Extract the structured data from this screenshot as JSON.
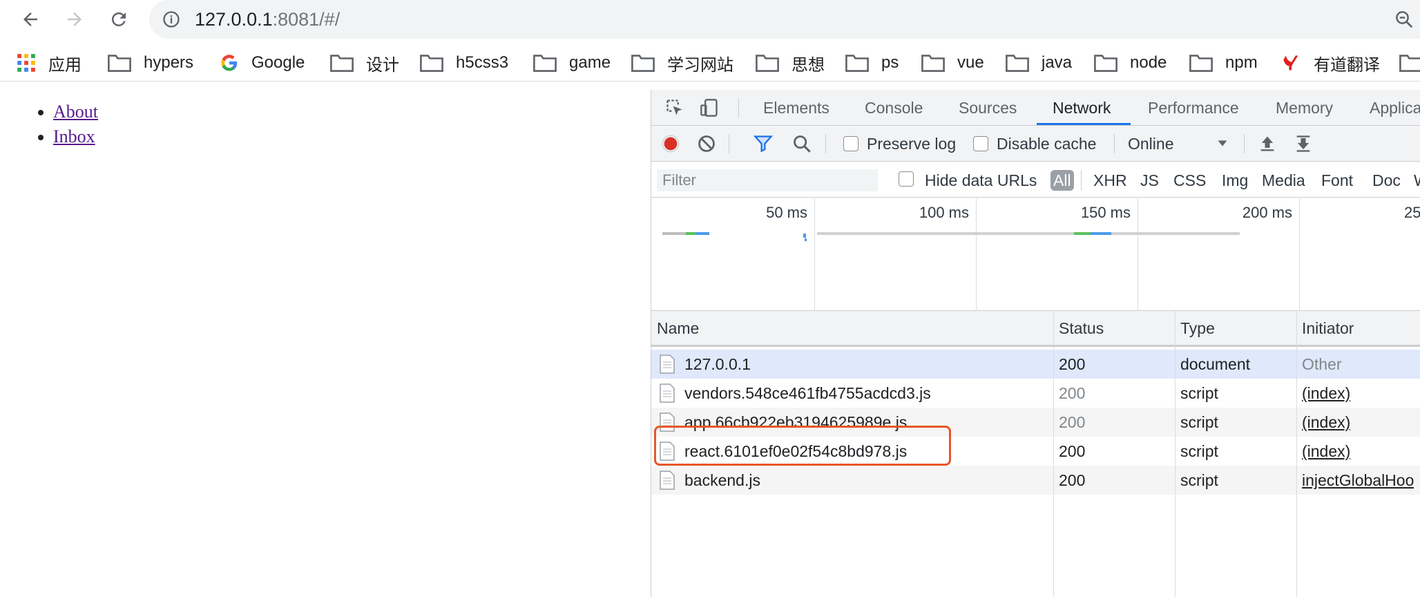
{
  "browser": {
    "url_host": "127.0.0.1",
    "url_rest": ":8081/#/",
    "bookmarks": [
      {
        "label": "应用",
        "icon": "apps-grid-icon"
      },
      {
        "label": "hypers",
        "icon": "folder-icon"
      },
      {
        "label": "Google",
        "icon": "google-icon"
      },
      {
        "label": "设计",
        "icon": "folder-icon"
      },
      {
        "label": "h5css3",
        "icon": "folder-icon"
      },
      {
        "label": "game",
        "icon": "folder-icon"
      },
      {
        "label": "学习网站",
        "icon": "folder-icon"
      },
      {
        "label": "思想",
        "icon": "folder-icon"
      },
      {
        "label": "ps",
        "icon": "folder-icon"
      },
      {
        "label": "vue",
        "icon": "folder-icon"
      },
      {
        "label": "java",
        "icon": "folder-icon"
      },
      {
        "label": "node",
        "icon": "folder-icon"
      },
      {
        "label": "npm",
        "icon": "folder-icon"
      },
      {
        "label": "有道翻译",
        "icon": "youdao-icon"
      }
    ]
  },
  "page": {
    "links": [
      "About",
      "Inbox"
    ]
  },
  "devtools": {
    "tabs": [
      "Elements",
      "Console",
      "Sources",
      "Network",
      "Performance",
      "Memory",
      "Applica"
    ],
    "active_tab": "Network",
    "controls": {
      "preserve_log": "Preserve log",
      "disable_cache": "Disable cache",
      "throttle": "Online"
    },
    "filter": {
      "placeholder": "Filter",
      "hide_data_urls": "Hide data URLs",
      "types": [
        "All",
        "XHR",
        "JS",
        "CSS",
        "Img",
        "Media",
        "Font",
        "Doc",
        "W"
      ]
    },
    "overview_ticks": [
      "50 ms",
      "100 ms",
      "150 ms",
      "200 ms",
      "25"
    ],
    "columns": [
      "Name",
      "Status",
      "Type",
      "Initiator"
    ],
    "rows": [
      {
        "name": "127.0.0.1",
        "status": "200",
        "type": "document",
        "initiator": "Other"
      },
      {
        "name": "vendors.548ce461fb4755acdcd3.js",
        "status": "200",
        "type": "script",
        "initiator": "(index)"
      },
      {
        "name": "app.66cb922eb3194625989e.js",
        "status": "200",
        "type": "script",
        "initiator": "(index)"
      },
      {
        "name": "react.6101ef0e02f54c8bd978.js",
        "status": "200",
        "type": "script",
        "initiator": "(index)"
      },
      {
        "name": "backend.js",
        "status": "200",
        "type": "script",
        "initiator": "injectGlobalHoo"
      }
    ]
  },
  "colors": {
    "record": "#d93025",
    "accent": "#1a73e8",
    "highlight_box": "#e8562a"
  }
}
